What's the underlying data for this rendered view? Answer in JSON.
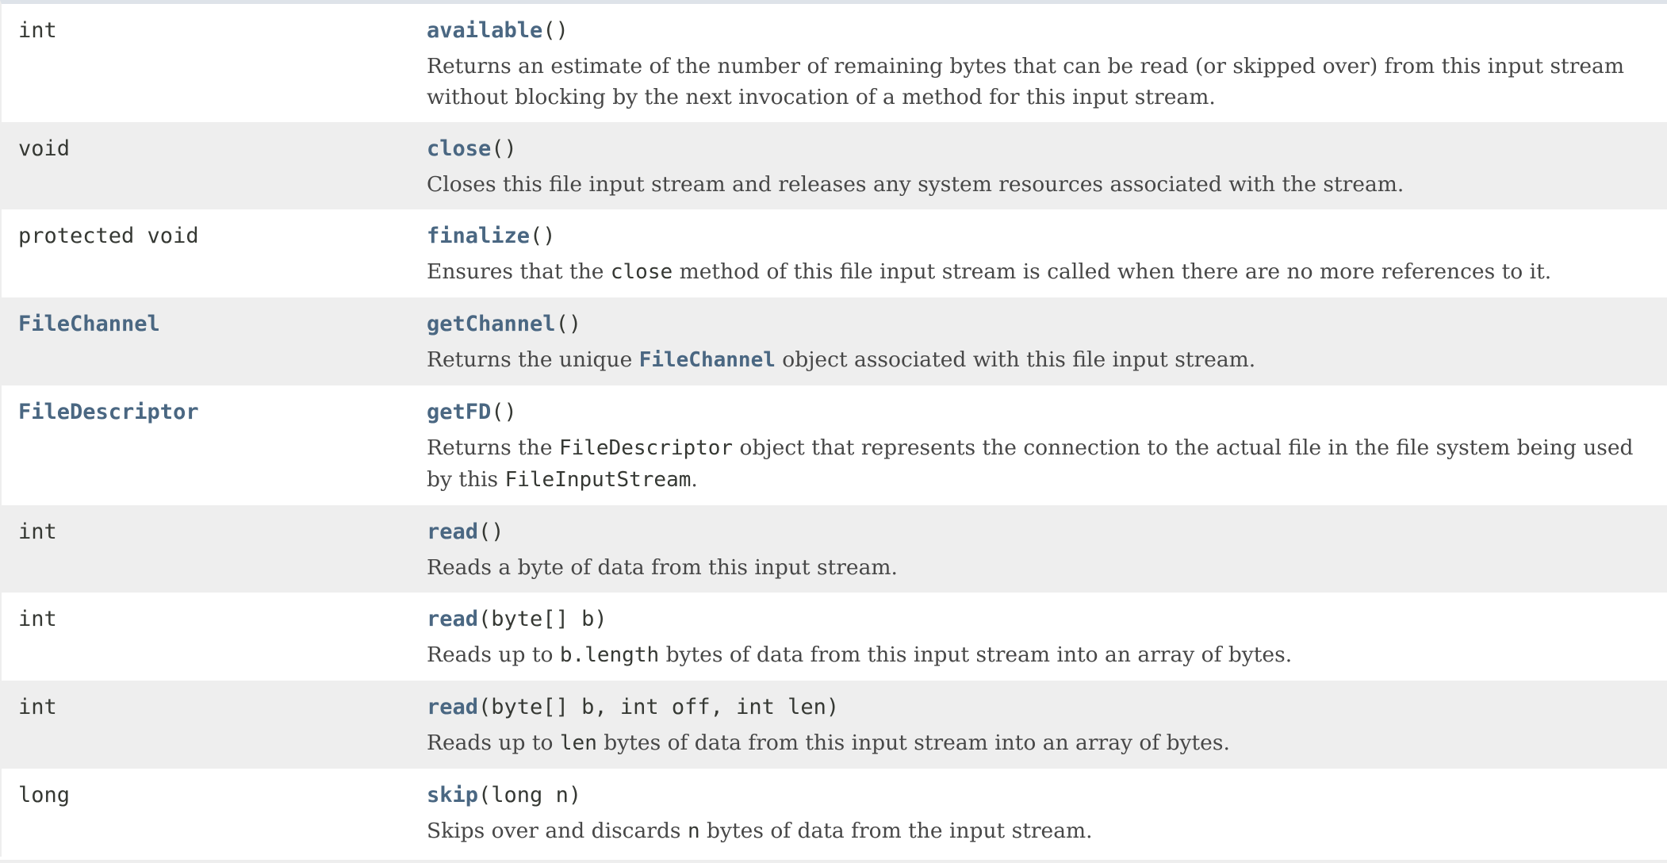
{
  "method_summary": {
    "rows": [
      {
        "modifier": "int",
        "modifier_is_link": false,
        "method_name": "available",
        "params": "()",
        "description": [
          {
            "text": "Returns an estimate of the number of remaining bytes that can be read (or skipped over) from this input stream without blocking by the next invocation of a method for this input stream."
          }
        ]
      },
      {
        "modifier": "void",
        "modifier_is_link": false,
        "method_name": "close",
        "params": "()",
        "description": [
          {
            "text": "Closes this file input stream and releases any system resources associated with the stream."
          }
        ]
      },
      {
        "modifier": "protected void",
        "modifier_is_link": false,
        "method_name": "finalize",
        "params": "()",
        "description": [
          {
            "text": "Ensures that the "
          },
          {
            "code": "close"
          },
          {
            "text": " method of this file input stream is called when there are no more references to it."
          }
        ]
      },
      {
        "modifier": "FileChannel",
        "modifier_is_link": true,
        "method_name": "getChannel",
        "params": "()",
        "description": [
          {
            "text": "Returns the unique "
          },
          {
            "link": "FileChannel"
          },
          {
            "text": " object associated with this file input stream."
          }
        ]
      },
      {
        "modifier": "FileDescriptor",
        "modifier_is_link": true,
        "method_name": "getFD",
        "params": "()",
        "description": [
          {
            "text": "Returns the "
          },
          {
            "code": "FileDescriptor"
          },
          {
            "text": " object that represents the connection to the actual file in the file system being used by this "
          },
          {
            "code": "FileInputStream"
          },
          {
            "text": "."
          }
        ]
      },
      {
        "modifier": "int",
        "modifier_is_link": false,
        "method_name": "read",
        "params": "()",
        "description": [
          {
            "text": "Reads a byte of data from this input stream."
          }
        ]
      },
      {
        "modifier": "int",
        "modifier_is_link": false,
        "method_name": "read",
        "params": "(byte[] b)",
        "description": [
          {
            "text": "Reads up to "
          },
          {
            "code": "b.length"
          },
          {
            "text": " bytes of data from this input stream into an array of bytes."
          }
        ]
      },
      {
        "modifier": "int",
        "modifier_is_link": false,
        "method_name": "read",
        "params": "(byte[] b, int off, int len)",
        "description": [
          {
            "text": "Reads up to "
          },
          {
            "code": "len"
          },
          {
            "text": " bytes of data from this input stream into an array of bytes."
          }
        ]
      },
      {
        "modifier": "long",
        "modifier_is_link": false,
        "method_name": "skip",
        "params": "(long n)",
        "description": [
          {
            "text": "Skips over and discards "
          },
          {
            "code": "n"
          },
          {
            "text": " bytes of data from the input stream."
          }
        ]
      }
    ]
  },
  "colors": {
    "link": "#4a6782",
    "text": "#353833",
    "description_text": "#474747",
    "row_alt_background": "#eeeeee",
    "header_strip": "#dee3e9"
  }
}
